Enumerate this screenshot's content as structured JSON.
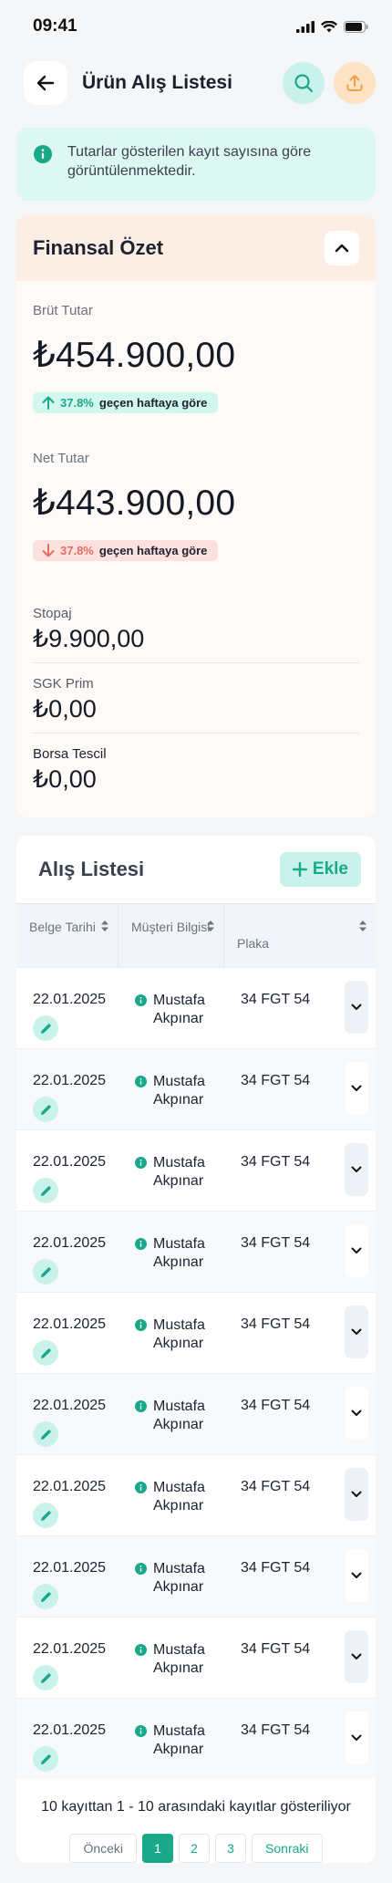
{
  "status_bar": {
    "time": "09:41"
  },
  "header": {
    "title": "Ürün Alış Listesi"
  },
  "info_banner": {
    "text": "Tutarlar gösterilen kayıt sayısına göre görüntülenmektedir."
  },
  "finance": {
    "title": "Finansal Özet",
    "gross": {
      "label": "Brüt Tutar",
      "amount": "₺454.900,00",
      "trend_pct": "37.8%",
      "trend_text": "geçen haftaya göre",
      "direction": "up"
    },
    "net": {
      "label": "Net Tutar",
      "amount": "₺443.900,00",
      "trend_pct": "37.8%",
      "trend_text": "geçen haftaya göre",
      "direction": "down"
    },
    "items": [
      {
        "label": "Stopaj",
        "amount": "₺9.900,00"
      },
      {
        "label": "SGK Prim",
        "amount": "₺0,00"
      },
      {
        "label": "Borsa Tescil",
        "amount": "₺0,00"
      }
    ]
  },
  "list": {
    "title": "Alış Listesi",
    "add_label": "Ekle",
    "columns": [
      {
        "label": "Belge Tarihi"
      },
      {
        "label": "Müşteri Bilgisi"
      },
      {
        "label": "Plaka"
      }
    ],
    "rows": [
      {
        "date": "22.01.2025",
        "customer": "Mustafa Akpınar",
        "plate": "34 FGT 54"
      },
      {
        "date": "22.01.2025",
        "customer": "Mustafa Akpınar",
        "plate": "34 FGT 54"
      },
      {
        "date": "22.01.2025",
        "customer": "Mustafa Akpınar",
        "plate": "34 FGT 54"
      },
      {
        "date": "22.01.2025",
        "customer": "Mustafa Akpınar",
        "plate": "34 FGT 54"
      },
      {
        "date": "22.01.2025",
        "customer": "Mustafa Akpınar",
        "plate": "34 FGT 54"
      },
      {
        "date": "22.01.2025",
        "customer": "Mustafa Akpınar",
        "plate": "34 FGT 54"
      },
      {
        "date": "22.01.2025",
        "customer": "Mustafa Akpınar",
        "plate": "34 FGT 54"
      },
      {
        "date": "22.01.2025",
        "customer": "Mustafa Akpınar",
        "plate": "34 FGT 54"
      },
      {
        "date": "22.01.2025",
        "customer": "Mustafa Akpınar",
        "plate": "34 FGT 54"
      },
      {
        "date": "22.01.2025",
        "customer": "Mustafa Akpınar",
        "plate": "34 FGT 54"
      }
    ],
    "pagination": {
      "summary": "10 kayıttan 1 - 10 arasındaki kayıtlar gösteriliyor",
      "prev_label": "Önceki",
      "pages": [
        "1",
        "2",
        "3"
      ],
      "current": "1",
      "next_label": "Sonraki"
    }
  },
  "colors": {
    "accent": "#1aa88b",
    "accent_soft": "#c9f3ea",
    "warm_soft": "#fceee4",
    "danger": "#e56e62"
  }
}
